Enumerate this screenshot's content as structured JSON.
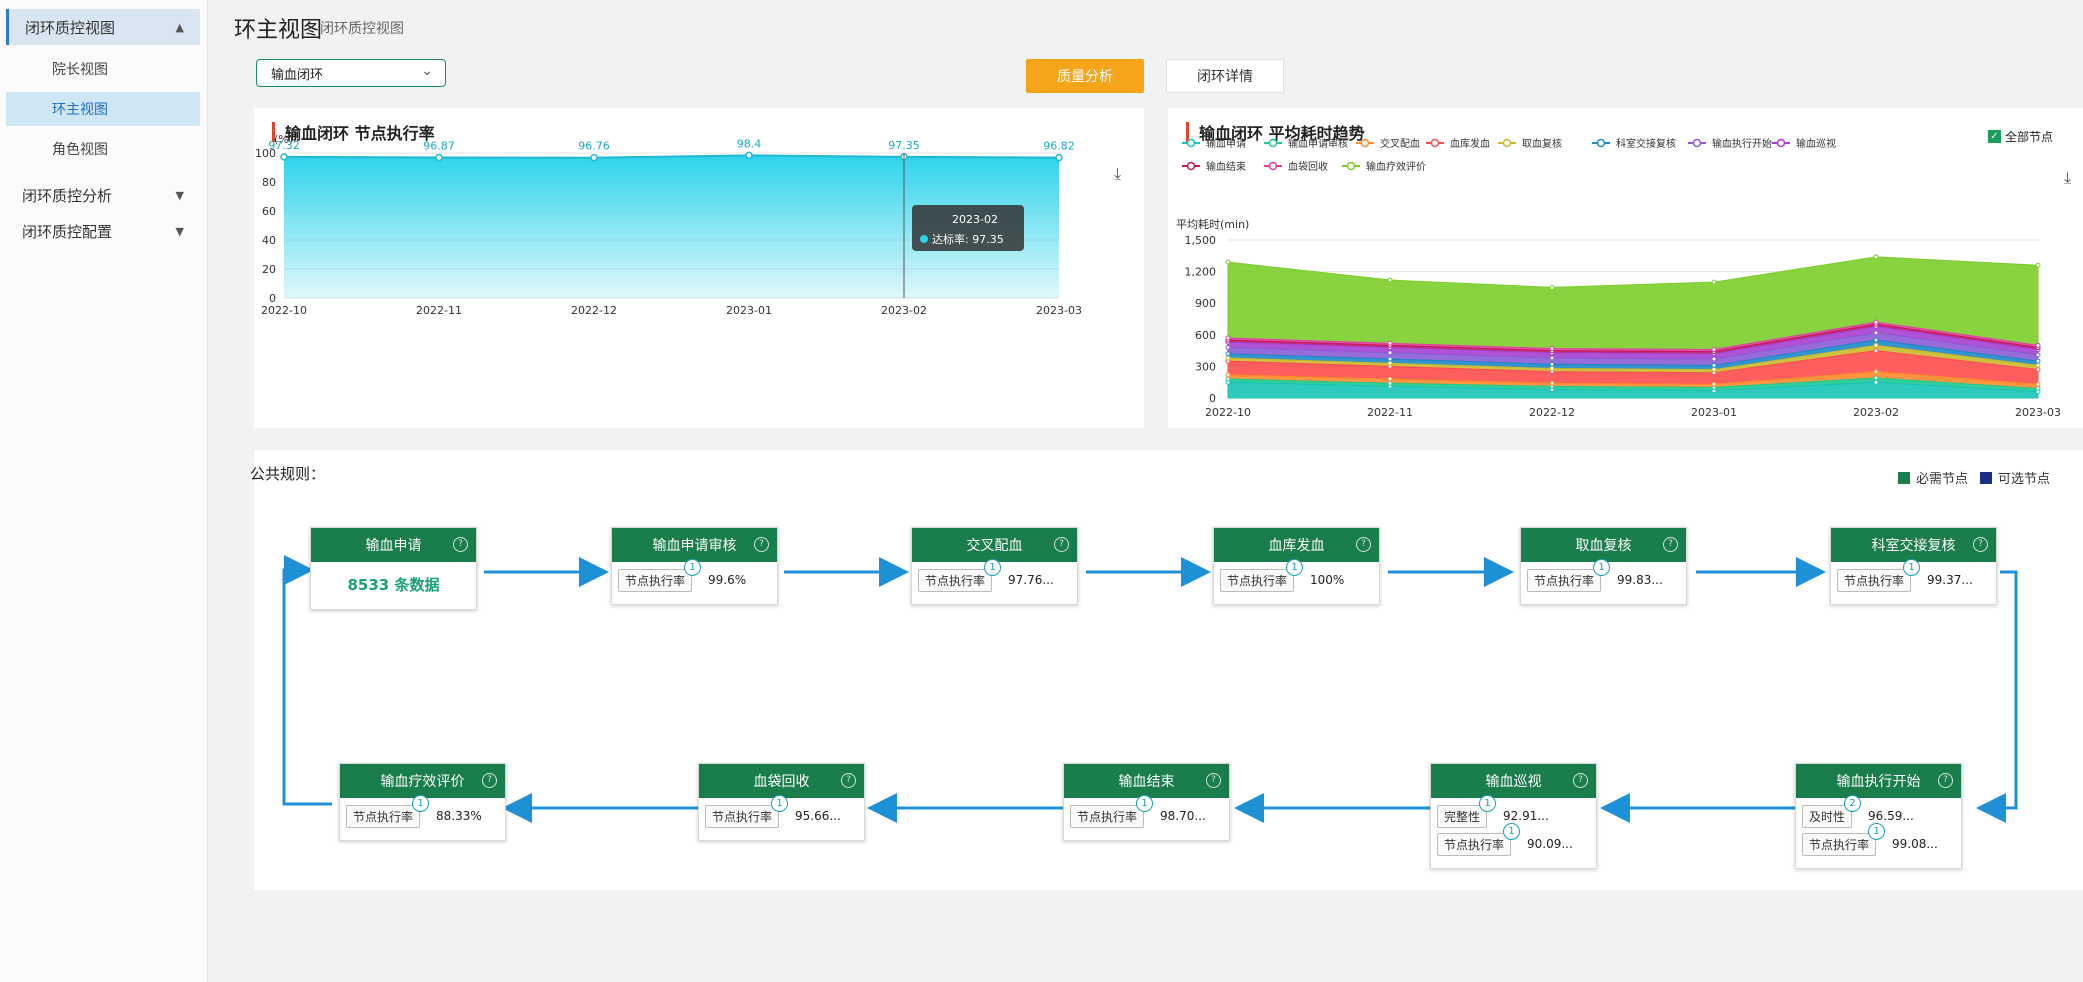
{
  "sidebar": {
    "groups": [
      {
        "label": "闭环质控视图",
        "caret": "▲"
      },
      {
        "label": "闭环质控分析",
        "caret": "▼"
      },
      {
        "label": "闭环质控配置",
        "caret": "▼"
      }
    ],
    "items": [
      {
        "label": "院长视图"
      },
      {
        "label": "环主视图"
      },
      {
        "label": "角色视图"
      }
    ]
  },
  "header": {
    "title": "环主视图",
    "breadcrumb": "闭环质控视图"
  },
  "filter": {
    "selected": "输血闭环",
    "chevron": "⌄"
  },
  "tabs": [
    {
      "label": "质量分析"
    },
    {
      "label": "闭环详情"
    }
  ],
  "colors": {
    "accent": "#1a7d4c",
    "tab_active": "#f6a51a",
    "arrow": "#1e90d6",
    "title_bar": "#e2432b"
  },
  "left_chart": {
    "title": "输血闭环 节点执行率",
    "download_icon": "download-icon",
    "tooltip": {
      "date": "2023-02",
      "label": "达标率: 97.35"
    }
  },
  "right_chart": {
    "title": "输血闭环 平均耗时趋势",
    "toggle_label": "全部节点",
    "download_icon": "download-icon"
  },
  "chart_data": [
    {
      "type": "area",
      "title": "输血闭环 节点执行率",
      "ylabel": "(%)",
      "x": [
        "2022-10",
        "2022-11",
        "2022-12",
        "2023-01",
        "2023-02",
        "2023-03"
      ],
      "values": [
        97.32,
        96.87,
        96.76,
        98.4,
        97.35,
        96.82
      ],
      "yticks": [
        0,
        20,
        40,
        60,
        80,
        100
      ],
      "ylim": [
        0,
        100
      ],
      "color": "#2ed3ea"
    },
    {
      "type": "area",
      "title": "输血闭环 平均耗时趋势",
      "ylabel": "平均耗时(min)",
      "x": [
        "2022-10",
        "2022-11",
        "2022-12",
        "2023-01",
        "2023-02",
        "2023-03"
      ],
      "yticks": [
        0,
        300,
        600,
        900,
        1200,
        1500
      ],
      "ytick_labels": [
        "0",
        "300",
        "600",
        "900",
        "1,200",
        "1,500"
      ],
      "ylim": [
        0,
        1500
      ],
      "legend_position": "top",
      "series": [
        {
          "name": "输血申请",
          "color": "#17c4b7",
          "values": [
            150,
            110,
            80,
            70,
            150,
            60
          ]
        },
        {
          "name": "输血申请审核",
          "color": "#1ec98e",
          "values": [
            30,
            30,
            30,
            30,
            40,
            30
          ]
        },
        {
          "name": "交叉配血",
          "color": "#ff8a2b",
          "values": [
            40,
            40,
            30,
            30,
            60,
            40
          ]
        },
        {
          "name": "血库发血",
          "color": "#ff4d4d",
          "values": [
            130,
            120,
            110,
            110,
            200,
            140
          ]
        },
        {
          "name": "取血复核",
          "color": "#c9b92b",
          "values": [
            30,
            30,
            30,
            30,
            50,
            40
          ]
        },
        {
          "name": "科室交接复核",
          "color": "#1e88c8",
          "values": [
            40,
            40,
            40,
            40,
            50,
            40
          ]
        },
        {
          "name": "输血执行开始",
          "color": "#8a5cd6",
          "values": [
            60,
            60,
            60,
            60,
            70,
            60
          ]
        },
        {
          "name": "输血巡视",
          "color": "#a73fd1",
          "values": [
            50,
            50,
            50,
            50,
            60,
            50
          ]
        },
        {
          "name": "输血结束",
          "color": "#c2185b",
          "values": [
            20,
            20,
            20,
            20,
            20,
            20
          ]
        },
        {
          "name": "血袋回收",
          "color": "#e040a0",
          "values": [
            20,
            20,
            20,
            20,
            20,
            20
          ]
        },
        {
          "name": "输血疗效评价",
          "color": "#7ccd2b",
          "values": [
            720,
            600,
            580,
            640,
            620,
            760
          ]
        }
      ]
    }
  ],
  "flow": {
    "rules_label": "公共规则：",
    "legend": [
      {
        "label": "必需节点",
        "color": "#1a7d4c"
      },
      {
        "label": "可选节点",
        "color": "#1c2f86"
      }
    ],
    "nodes": [
      {
        "title": "输血申请",
        "count": "8533 条数据"
      },
      {
        "title": "输血申请审核",
        "metrics": [
          {
            "tag": "节点执行率",
            "badge": "1",
            "value": "99.6%"
          }
        ]
      },
      {
        "title": "交叉配血",
        "metrics": [
          {
            "tag": "节点执行率",
            "badge": "1",
            "value": "97.76..."
          }
        ]
      },
      {
        "title": "血库发血",
        "metrics": [
          {
            "tag": "节点执行率",
            "badge": "1",
            "value": "100%"
          }
        ]
      },
      {
        "title": "取血复核",
        "metrics": [
          {
            "tag": "节点执行率",
            "badge": "1",
            "value": "99.83..."
          }
        ]
      },
      {
        "title": "科室交接复核",
        "metrics": [
          {
            "tag": "节点执行率",
            "badge": "1",
            "value": "99.37..."
          }
        ]
      },
      {
        "title": "输血执行开始",
        "metrics": [
          {
            "tag": "及时性",
            "badge": "2",
            "value": "96.59..."
          },
          {
            "tag": "节点执行率",
            "badge": "1",
            "value": "99.08..."
          }
        ]
      },
      {
        "title": "输血巡视",
        "metrics": [
          {
            "tag": "完整性",
            "badge": "1",
            "value": "92.91..."
          },
          {
            "tag": "节点执行率",
            "badge": "1",
            "value": "90.09..."
          }
        ]
      },
      {
        "title": "输血结束",
        "metrics": [
          {
            "tag": "节点执行率",
            "badge": "1",
            "value": "98.70..."
          }
        ]
      },
      {
        "title": "血袋回收",
        "metrics": [
          {
            "tag": "节点执行率",
            "badge": "1",
            "value": "95.66..."
          }
        ]
      },
      {
        "title": "输血疗效评价",
        "metrics": [
          {
            "tag": "节点执行率",
            "badge": "1",
            "value": "88.33%"
          }
        ]
      }
    ]
  }
}
